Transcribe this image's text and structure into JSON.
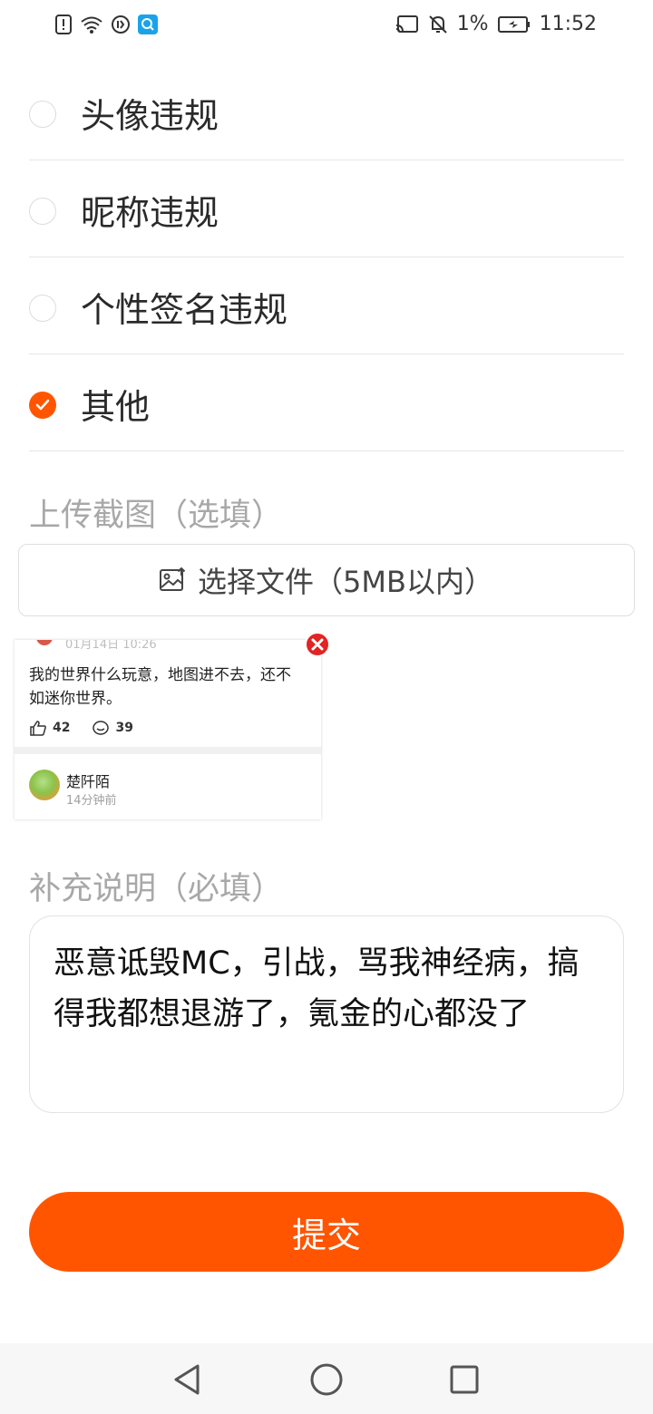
{
  "status_bar": {
    "battery": "1%",
    "time": "11:52",
    "left_icons": [
      "alert-icon",
      "wifi-icon",
      "data-saver-icon",
      "search-app-icon"
    ],
    "right_icons": [
      "cast-icon",
      "mute-icon",
      "battery-icon"
    ]
  },
  "reasons": [
    {
      "label": "头像违规",
      "checked": false
    },
    {
      "label": "昵称违规",
      "checked": false
    },
    {
      "label": "个性签名违规",
      "checked": false
    },
    {
      "label": "其他",
      "checked": true
    }
  ],
  "upload": {
    "title": "上传截图（选填）",
    "button_label": "选择文件（5MB以内）"
  },
  "thumbnail": {
    "date": "01月14日 10:26",
    "text": "我的世界什么玩意，地图进不去，还不如迷你世界。",
    "likes": "42",
    "comments": "39",
    "username": "楚阡陌",
    "time_ago": "14分钟前"
  },
  "description": {
    "title": "补充说明（必填）",
    "value": "恶意诋毁MC，引战，骂我神经病，搞得我都想退游了，氪金的心都没了"
  },
  "submit_label": "提交",
  "colors": {
    "accent": "#ff5500",
    "muted_text": "#a8a8a8",
    "close_red": "#e12424"
  }
}
